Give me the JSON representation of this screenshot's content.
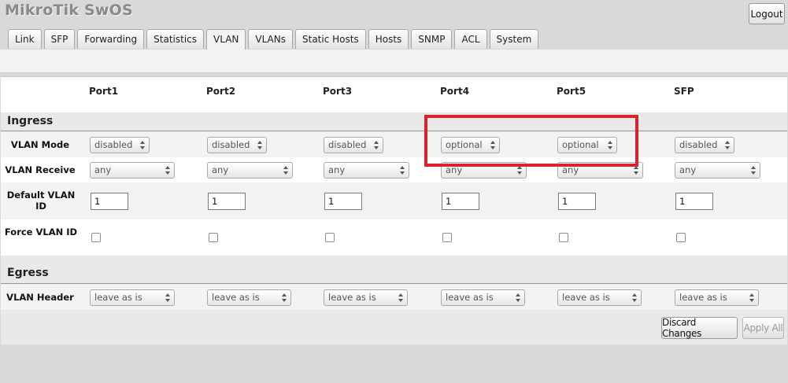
{
  "app": {
    "title": "MikroTik SwOS",
    "logout_label": "Logout"
  },
  "tabs": [
    "Link",
    "SFP",
    "Forwarding",
    "Statistics",
    "VLAN",
    "VLANs",
    "Static Hosts",
    "Hosts",
    "SNMP",
    "ACL",
    "System"
  ],
  "active_tab": "VLAN",
  "columns": [
    "Port1",
    "Port2",
    "Port3",
    "Port4",
    "Port5",
    "SFP"
  ],
  "ingress": {
    "title": "Ingress",
    "vlan_mode": {
      "label": "VLAN Mode",
      "values": [
        "disabled",
        "disabled",
        "disabled",
        "optional",
        "optional",
        "disabled"
      ]
    },
    "vlan_receive": {
      "label": "VLAN Receive",
      "values": [
        "any",
        "any",
        "any",
        "any",
        "any",
        "any"
      ]
    },
    "default_vlan_id": {
      "label": "Default VLAN ID",
      "values": [
        "1",
        "1",
        "1",
        "1",
        "1",
        "1"
      ]
    },
    "force_vlan_id": {
      "label": "Force VLAN ID",
      "values": [
        false,
        false,
        false,
        false,
        false,
        false
      ]
    }
  },
  "egress": {
    "title": "Egress",
    "vlan_header": {
      "label": "VLAN Header",
      "values": [
        "leave as is",
        "leave as is",
        "leave as is",
        "leave as is",
        "leave as is",
        "leave as is"
      ]
    }
  },
  "buttons": {
    "discard": "Discard Changes",
    "apply": "Apply All"
  },
  "colors": {
    "highlight": "#d9232e",
    "background": "#d9d9d9"
  }
}
